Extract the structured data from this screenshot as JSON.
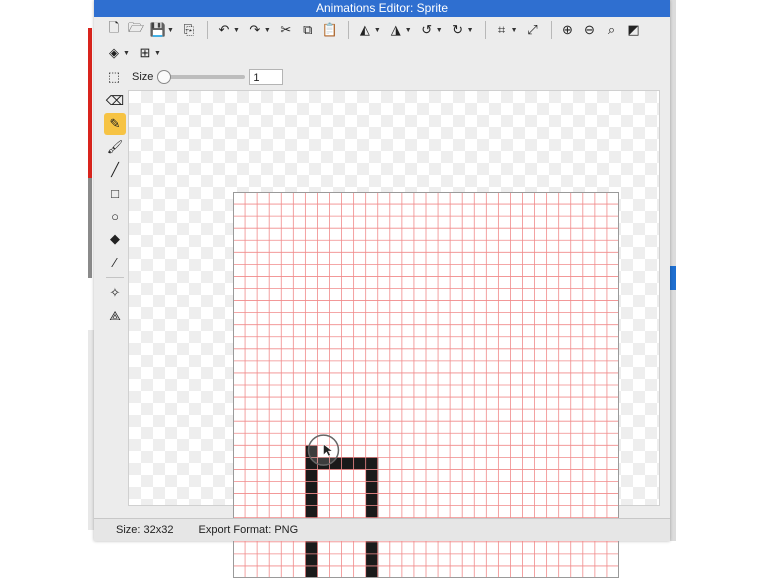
{
  "window": {
    "title": "Animations Editor: Sprite"
  },
  "toolbar": {
    "row1": [
      {
        "icon": "new-file-icon",
        "glyph": "🗋",
        "dropdown": false
      },
      {
        "icon": "open-folder-icon",
        "glyph": "🗁",
        "dropdown": false
      },
      {
        "icon": "save-icon",
        "glyph": "💾",
        "dropdown": true
      },
      {
        "icon": "import-icon",
        "glyph": "⎘",
        "dropdown": false
      },
      {
        "sep": true
      },
      {
        "icon": "undo-icon",
        "glyph": "↶",
        "dropdown": true
      },
      {
        "icon": "redo-icon",
        "glyph": "↷",
        "dropdown": true
      },
      {
        "icon": "cut-icon",
        "glyph": "✂",
        "dropdown": false
      },
      {
        "icon": "copy-icon",
        "glyph": "⧉",
        "dropdown": false
      },
      {
        "icon": "paste-icon",
        "glyph": "📋",
        "dropdown": false
      },
      {
        "sep": true
      },
      {
        "icon": "flip-horizontal-icon",
        "glyph": "◭",
        "dropdown": true
      },
      {
        "icon": "flip-vertical-icon",
        "glyph": "◮",
        "dropdown": true
      },
      {
        "icon": "rotate-left-icon",
        "glyph": "↺",
        "dropdown": true
      },
      {
        "icon": "rotate-right-icon",
        "glyph": "↻",
        "dropdown": true
      },
      {
        "sep": true
      },
      {
        "icon": "crop-icon",
        "glyph": "⌗",
        "dropdown": true
      },
      {
        "icon": "resize-icon",
        "glyph": "⤢",
        "dropdown": false
      },
      {
        "sep": true
      },
      {
        "icon": "zoom-in-icon",
        "glyph": "⊕",
        "dropdown": false
      },
      {
        "icon": "zoom-out-icon",
        "glyph": "⊖",
        "dropdown": false
      },
      {
        "icon": "zoom-fit-icon",
        "glyph": "⌕",
        "dropdown": false
      },
      {
        "icon": "background-toggle-icon",
        "glyph": "◩",
        "dropdown": false
      }
    ],
    "row2": [
      {
        "icon": "layers-icon",
        "glyph": "◈",
        "dropdown": true
      },
      {
        "icon": "grid-icon",
        "glyph": "⊞",
        "dropdown": true
      }
    ]
  },
  "brush": {
    "size_label": "Size",
    "size_value": "1",
    "slider_fraction": 0.0
  },
  "tools": [
    {
      "icon": "eraser-icon",
      "glyph": "⌫",
      "active": false
    },
    {
      "icon": "pencil-icon",
      "glyph": "✎",
      "active": true
    },
    {
      "icon": "brush-icon",
      "glyph": "🖌",
      "active": false
    },
    {
      "icon": "line-icon",
      "glyph": "╱",
      "active": false
    },
    {
      "icon": "rectangle-icon",
      "glyph": "□",
      "active": false
    },
    {
      "icon": "ellipse-icon",
      "glyph": "○",
      "active": false
    },
    {
      "icon": "fill-bucket-icon",
      "glyph": "◆",
      "active": false
    },
    {
      "icon": "eyedropper-icon",
      "glyph": "⁄",
      "active": false
    },
    {
      "sep": true
    },
    {
      "icon": "origin-point-icon",
      "glyph": "✧",
      "active": false
    },
    {
      "icon": "polygon-points-icon",
      "glyph": "⟁",
      "active": false
    }
  ],
  "sprite": {
    "grid_cols": 32,
    "grid_rows": 32,
    "grid_color": "#f08a8a",
    "pixel_color": "#1a1a1a",
    "filled_cells": [
      [
        6,
        21
      ],
      [
        6,
        22
      ],
      [
        7,
        22
      ],
      [
        8,
        22
      ],
      [
        9,
        22
      ],
      [
        10,
        22
      ],
      [
        11,
        22
      ],
      [
        6,
        23
      ],
      [
        6,
        24
      ],
      [
        6,
        25
      ],
      [
        6,
        26
      ],
      [
        6,
        27
      ],
      [
        6,
        28
      ],
      [
        6,
        29
      ],
      [
        6,
        30
      ],
      [
        6,
        31
      ],
      [
        11,
        23
      ],
      [
        11,
        24
      ],
      [
        11,
        25
      ],
      [
        11,
        26
      ],
      [
        11,
        27
      ],
      [
        11,
        28
      ],
      [
        11,
        29
      ],
      [
        11,
        30
      ],
      [
        11,
        31
      ]
    ],
    "cursor_cell": [
      7,
      21
    ]
  },
  "status": {
    "size_text": "Size: 32x32",
    "export_text": "Export Format: PNG"
  }
}
